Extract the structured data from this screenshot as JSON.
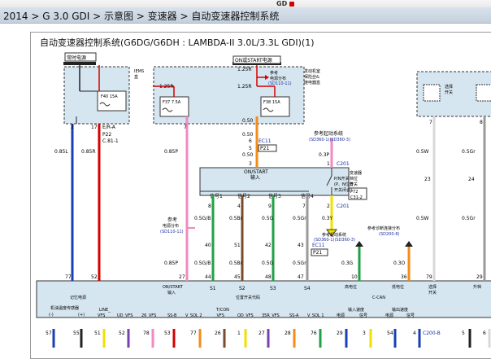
{
  "header": {
    "logo": "GD",
    "breadcrumb": "2014 > G 3.0 GDI > 示意图 > 变速器 > 自动变速器控制系统"
  },
  "diagram": {
    "title": "自动变速器控制系统(G6DG/G6DH : LAMBDA-II 3.0L/3.3L GDI)(1)",
    "box_constant": "常时电源",
    "box_onstart": "ON或START电源",
    "label_iems": "IEMS",
    "label_iems2": "盒",
    "label_engine_box": "发动机室",
    "label_engine_box2": "保险丝&",
    "label_engine_box3": "继电器盒",
    "fuse_f40": "F40 15A",
    "fuse_f37": "F37 7.5A",
    "fuse_f38": "F38 15A",
    "ref_power": "参考",
    "ref_power2": "电源分布",
    "ref_power3": "(SD110-11)",
    "ref_power_left": "参考",
    "ref_power_left2": "电源分布",
    "ref_power_left3": "(SD110-11)",
    "ref_start": "参考起动系统",
    "ref_start2": "(SD360-1)(SD360-3)",
    "ref_start_b": "参考起动系统",
    "ref_start_b2": "(SD360-1)(SD360-3)",
    "ref_diag": "参考诊断连接分布",
    "ref_diag2": "(SD200-8)",
    "tr_switch": "变速器",
    "tr_switch2": "档位",
    "tr_switch3": "开关",
    "tr_switch4": "P72",
    "tr_switch5": "C31-2",
    "sel_switch": "选择",
    "sel_switch2": "开关",
    "pn_switch": "P/N开关",
    "pn_switch2": "(P、N位置",
    "pn_switch3": "开关闭合)",
    "onstart_in": "ON/START",
    "onstart_in2": "输入",
    "sig1": "信号1",
    "sig2": "信号2",
    "sig3": "信号3",
    "sig4": "信号4",
    "w_1_25r_a": "1.25R",
    "w_1_25r_b": "1.25R",
    "w_1_25r_c": "1.25R",
    "w_0_85l": "0.85L",
    "w_0_85r": "0.85R",
    "w_0_85p_a": "0.85P",
    "w_0_85p_b": "0.85P",
    "w_0_50_a": "0.50",
    "w_0_50_b": "0.50",
    "w_0_3p": "0.3P",
    "w_0_3y_a": "0.3Y",
    "w_0_5gb_a": "0.5G/B",
    "w_0_5br_a": "0.5Br",
    "w_0_5g_a": "0.5G",
    "w_0_5gr_a": "0.5Gr",
    "w_0_5gb_b": "0.5G/B",
    "w_0_5br_b": "0.5Br",
    "w_0_5g_b": "0.5G",
    "w_0_5gr_b": "0.5Gr",
    "w_0_3g": "0.3G",
    "w_0_3o": "0.3O",
    "w_0_5w_a": "0.5W",
    "w_0_5w_b": "0.5W",
    "w_0_5gr_c": "0.5Gr",
    "w_0_5gr_d": "0.5Gr",
    "conn_era": "E/R-A",
    "conn_p22": "P22",
    "conn_c811": "C.81-1",
    "conn_ec11_a": "EC11",
    "conn_p21_a": "P21",
    "conn_c201_a": "C201",
    "conn_c201_b": "C201",
    "conn_ec11_b": "EC11",
    "conn_p21_b": "P21",
    "pin_2": "2",
    "pin_17": "17",
    "pin_7": "7",
    "pin_8": "8",
    "pin_6": "6",
    "pin_5": "5",
    "pin_3": "3",
    "pin_1": "1",
    "pin_2b": "2",
    "pin_8b": "8",
    "pin_4": "4",
    "pin_9": "9",
    "pin_7b": "7",
    "pin_40": "40",
    "pin_51": "51",
    "pin_42": "42",
    "pin_43": "43",
    "pin_23": "23",
    "pin_24": "24",
    "pin_77": "77",
    "pin_52": "52",
    "pin_27": "27",
    "pin_44": "44",
    "pin_45": "45",
    "pin_48": "48",
    "pin_47": "47",
    "pin_10": "10",
    "pin_36": "36",
    "pin_79": "79",
    "pin_29": "29",
    "tcm_mem": "记忆电源",
    "tcm_onstart": "ON/START",
    "tcm_onstart2": "输入",
    "tcm_s1": "S1",
    "tcm_s2": "S2",
    "tcm_s3": "S3",
    "tcm_s4": "S4",
    "tcm_position": "位置开关代码",
    "tcm_high": "高电位",
    "tcm_low": "低电位",
    "tcm_ccan": "C-CAN",
    "tcm_sel": "选择",
    "tcm_sel2": "开关",
    "tcm_upshift": "升档",
    "bot_oil_temp": "机油温度传感器",
    "bot_minus": "(-)",
    "bot_plus": "(+)",
    "bot_line": "LINE_",
    "bot_vfs": "VFS",
    "bot_ud_vfs": "UD_VFS",
    "bot_26_vfs": "26_VFS",
    "bot_ss_b": "SS-B",
    "bot_v_sol2": "V_SOL 2",
    "bot_tcon": "T/CON",
    "bot_vfs2": "_VFS",
    "bot_od_vfs": "OD_VFS",
    "bot_35r_vfs": "35R_VFS",
    "bot_ss_a": "SS-A",
    "bot_v_sol1": "V_SOL 1",
    "bot_in_speed": "输入速度",
    "bot_out_speed": "输出速度",
    "bot_power1": "电源",
    "bot_sig1": "信号",
    "bot_power2": "电源",
    "bot_sig2": "信号",
    "bp_57": "57",
    "bp_55": "55",
    "bp_51": "51",
    "bp_52": "52",
    "bp_78": "78",
    "bp_53": "53",
    "bp_77": "77",
    "bp_26": "26",
    "bp_1": "1",
    "bp_27": "27",
    "bp_28": "28",
    "bp_76": "76",
    "bp_29": "29",
    "bp_3": "3",
    "bp_54": "54",
    "bp_4": "4",
    "bp_c200b": "C200-B",
    "bp_5": "5",
    "bp_6": "6"
  }
}
